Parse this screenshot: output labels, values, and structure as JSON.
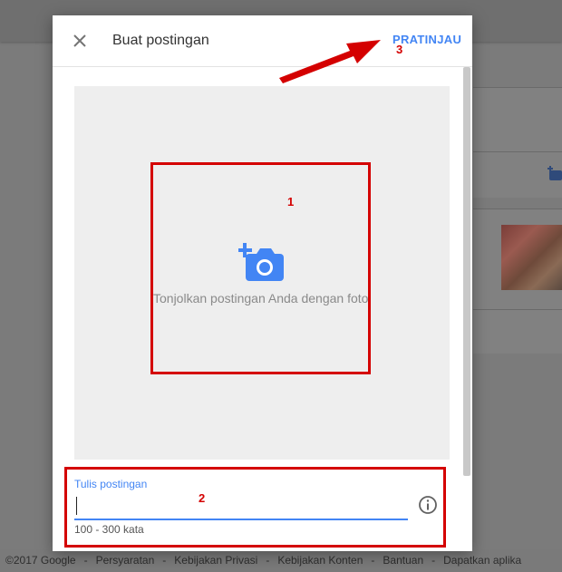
{
  "dialog": {
    "title": "Buat postingan",
    "preview_label": "PRATINJAU",
    "photo_caption": "Tonjolkan postingan Anda dengan foto",
    "post_label": "Tulis postingan",
    "post_value": "",
    "word_count_hint": "100 - 300 kata"
  },
  "annotations": [
    "1",
    "2",
    "3"
  ],
  "footer": {
    "links": [
      "©2017 Google",
      "Persyaratan",
      "Kebijakan Privasi",
      "Kebijakan Konten",
      "Bantuan",
      "Dapatkan aplika"
    ],
    "separator": "-"
  },
  "icons": {
    "close": "close-icon",
    "camera": "add-photo-icon",
    "info": "info-icon"
  },
  "colors": {
    "accent": "#4285f4",
    "annotation": "#d40000",
    "overlay": "#7a7a7a"
  }
}
